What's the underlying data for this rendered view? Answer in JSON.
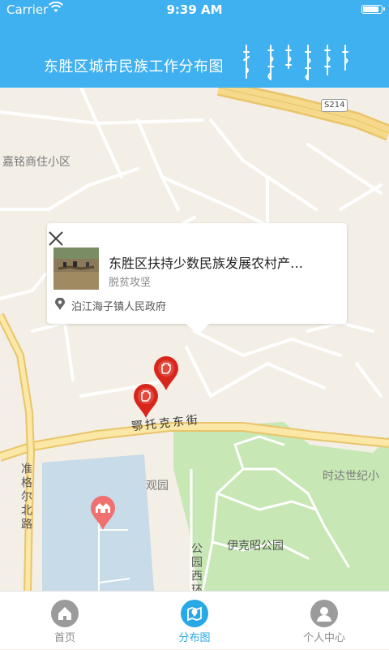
{
  "status_bar": {
    "carrier": "Carrier",
    "time": "9:39 AM"
  },
  "header": {
    "title": "东胜区城市民族工作分布图"
  },
  "map": {
    "road_shield": "S214",
    "labels": {
      "jiaming": "嘉铭商住小区",
      "erdos_street": "鄂托克东街",
      "zhungeer": "准格尔北路",
      "guanyuan": "观园",
      "yikezhao_park": "伊克昭公园",
      "gongyuan_xihuan": "公园西环",
      "shida": "时达世纪小"
    }
  },
  "popup": {
    "title": "东胜区扶持少数民族发展农村产…",
    "category": "脱贫攻坚",
    "location": "泊江海子镇人民政府"
  },
  "tabbar": {
    "items": [
      {
        "label": "首页",
        "icon": "home-icon",
        "active": false
      },
      {
        "label": "分布图",
        "icon": "map-icon",
        "active": true
      },
      {
        "label": "个人中心",
        "icon": "user-icon",
        "active": false
      }
    ],
    "active_color": "#29a8e6",
    "inactive_color": "#8a8a8a"
  },
  "colors": {
    "header": "#3fb0f0",
    "marker_red": "#d9261c",
    "marker_pink": "#f07070",
    "park_green": "#c7e7b5",
    "water_blue": "#c7dbe8",
    "highway": "#f4d77e"
  }
}
